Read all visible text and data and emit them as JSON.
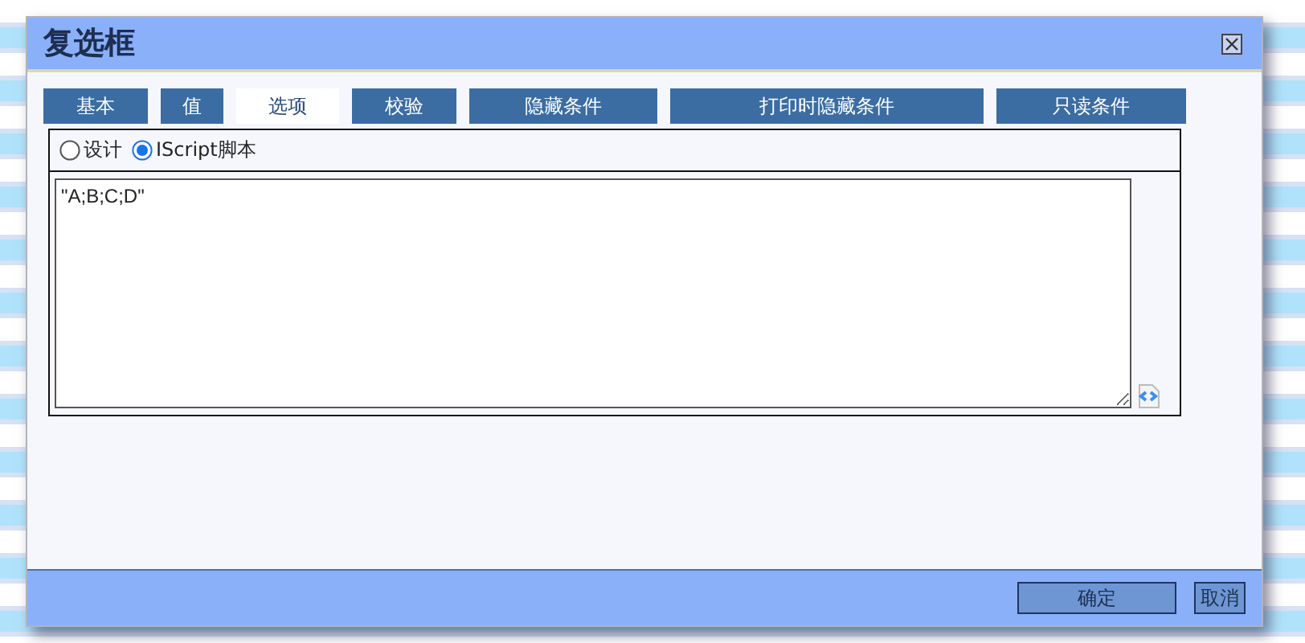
{
  "window": {
    "title": "复选框"
  },
  "tabs": [
    {
      "label": "基本",
      "selected": false
    },
    {
      "label": "值",
      "selected": false
    },
    {
      "label": "选项",
      "selected": true
    },
    {
      "label": "校验",
      "selected": false
    },
    {
      "label": "隐藏条件",
      "selected": false
    },
    {
      "label": "打印时隐藏条件",
      "selected": false
    },
    {
      "label": "只读条件",
      "selected": false
    }
  ],
  "mode_options": [
    {
      "label": "设计",
      "selected": false
    },
    {
      "label": "IScript脚本",
      "selected": true
    }
  ],
  "script_editor": {
    "value": "\"A;B;C;D\""
  },
  "buttons": [
    {
      "label": "确定",
      "kind": "primary"
    },
    {
      "label": "取消",
      "kind": "secondary"
    }
  ]
}
